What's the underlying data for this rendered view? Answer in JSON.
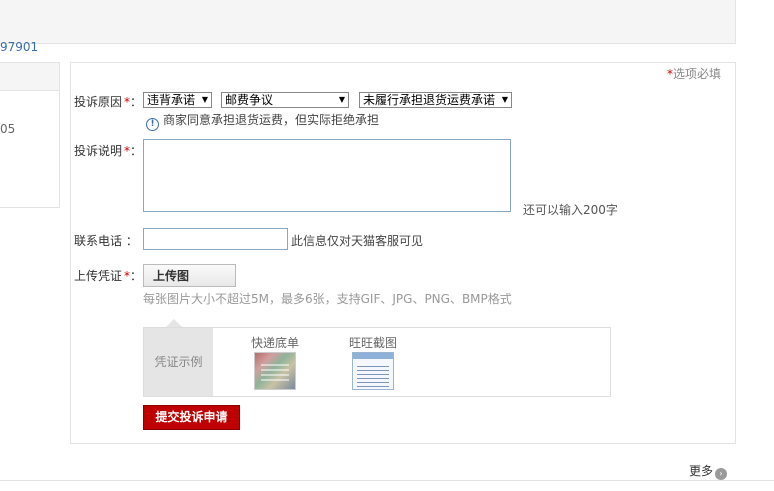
{
  "sidebar": {
    "link_text": "97901",
    "number_text": "05"
  },
  "form": {
    "required_note_star": "*",
    "required_note": "选项必填",
    "reason": {
      "label": "投诉原因",
      "star": "*",
      "colon": "：",
      "select1": "违背承诺",
      "select2": "邮费争议",
      "select3": "未履行承担退货运费承诺",
      "hint": "商家同意承担退货运费，但实际拒绝承担"
    },
    "description": {
      "label": "投诉说明",
      "star": "*",
      "colon": "：",
      "value": "",
      "counter": "还可以输入200字"
    },
    "phone": {
      "label": "联系电话 ：",
      "value": "",
      "note": "此信息仅对天猫客服可见"
    },
    "upload": {
      "label": "上传凭证",
      "star": "*",
      "colon": "：",
      "button": "上传图",
      "hint": "每张图片大小不超过5M，最多6张，支持GIF、JPG、PNG、BMP格式"
    },
    "samples": {
      "label": "凭证示例",
      "items": [
        {
          "caption": "快递底单"
        },
        {
          "caption": "旺旺截图"
        }
      ]
    },
    "submit_label": "提交投诉申请"
  },
  "footer": {
    "more_label": "更多"
  },
  "colors": {
    "submit": "#bf0000",
    "required_star": "#cc0000",
    "link": "#3a6da8"
  }
}
